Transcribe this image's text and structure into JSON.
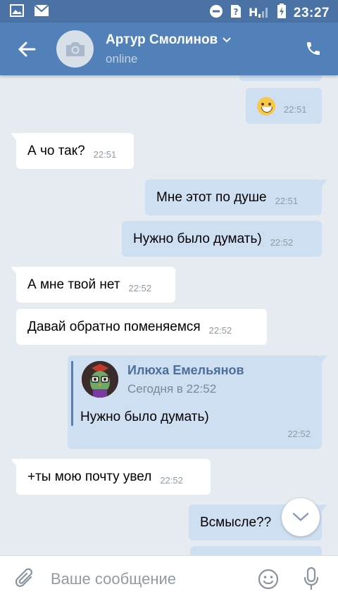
{
  "status_bar": {
    "time": "23:27",
    "network": "H"
  },
  "header": {
    "contact_name": "Артур Смолинов",
    "contact_status": "online"
  },
  "messages": [
    {
      "dir": "out",
      "emoji": "grinning-face",
      "time": "22:51"
    },
    {
      "dir": "in",
      "text": "А чо так?",
      "time": "22:51"
    },
    {
      "dir": "out",
      "text": "Мне этот по душе",
      "time": "22:51"
    },
    {
      "dir": "out",
      "text": "Нужно было думать)",
      "time": "22:52"
    },
    {
      "dir": "in",
      "text": "А мне твой нет",
      "time": "22:52"
    },
    {
      "dir": "in",
      "text": "Давай обратно поменяемся",
      "time": "22:52"
    },
    {
      "dir": "out",
      "forwarded": {
        "author": "Илюха Емельянов",
        "date": "Сегодня в 22:52",
        "text": "Нужно было думать)"
      },
      "time": "22:52"
    },
    {
      "dir": "in",
      "text": "+ты мою почту увел",
      "time": "22:52"
    },
    {
      "dir": "out",
      "text": "Всмысле??",
      "time": ""
    }
  ],
  "input": {
    "placeholder": "Ваше сообщение"
  },
  "colors": {
    "header": "#5181b8",
    "status_bar": "#4a72a4",
    "outgoing": "#cfdff2",
    "incoming": "#ffffff",
    "background": "#e6ebf1"
  }
}
